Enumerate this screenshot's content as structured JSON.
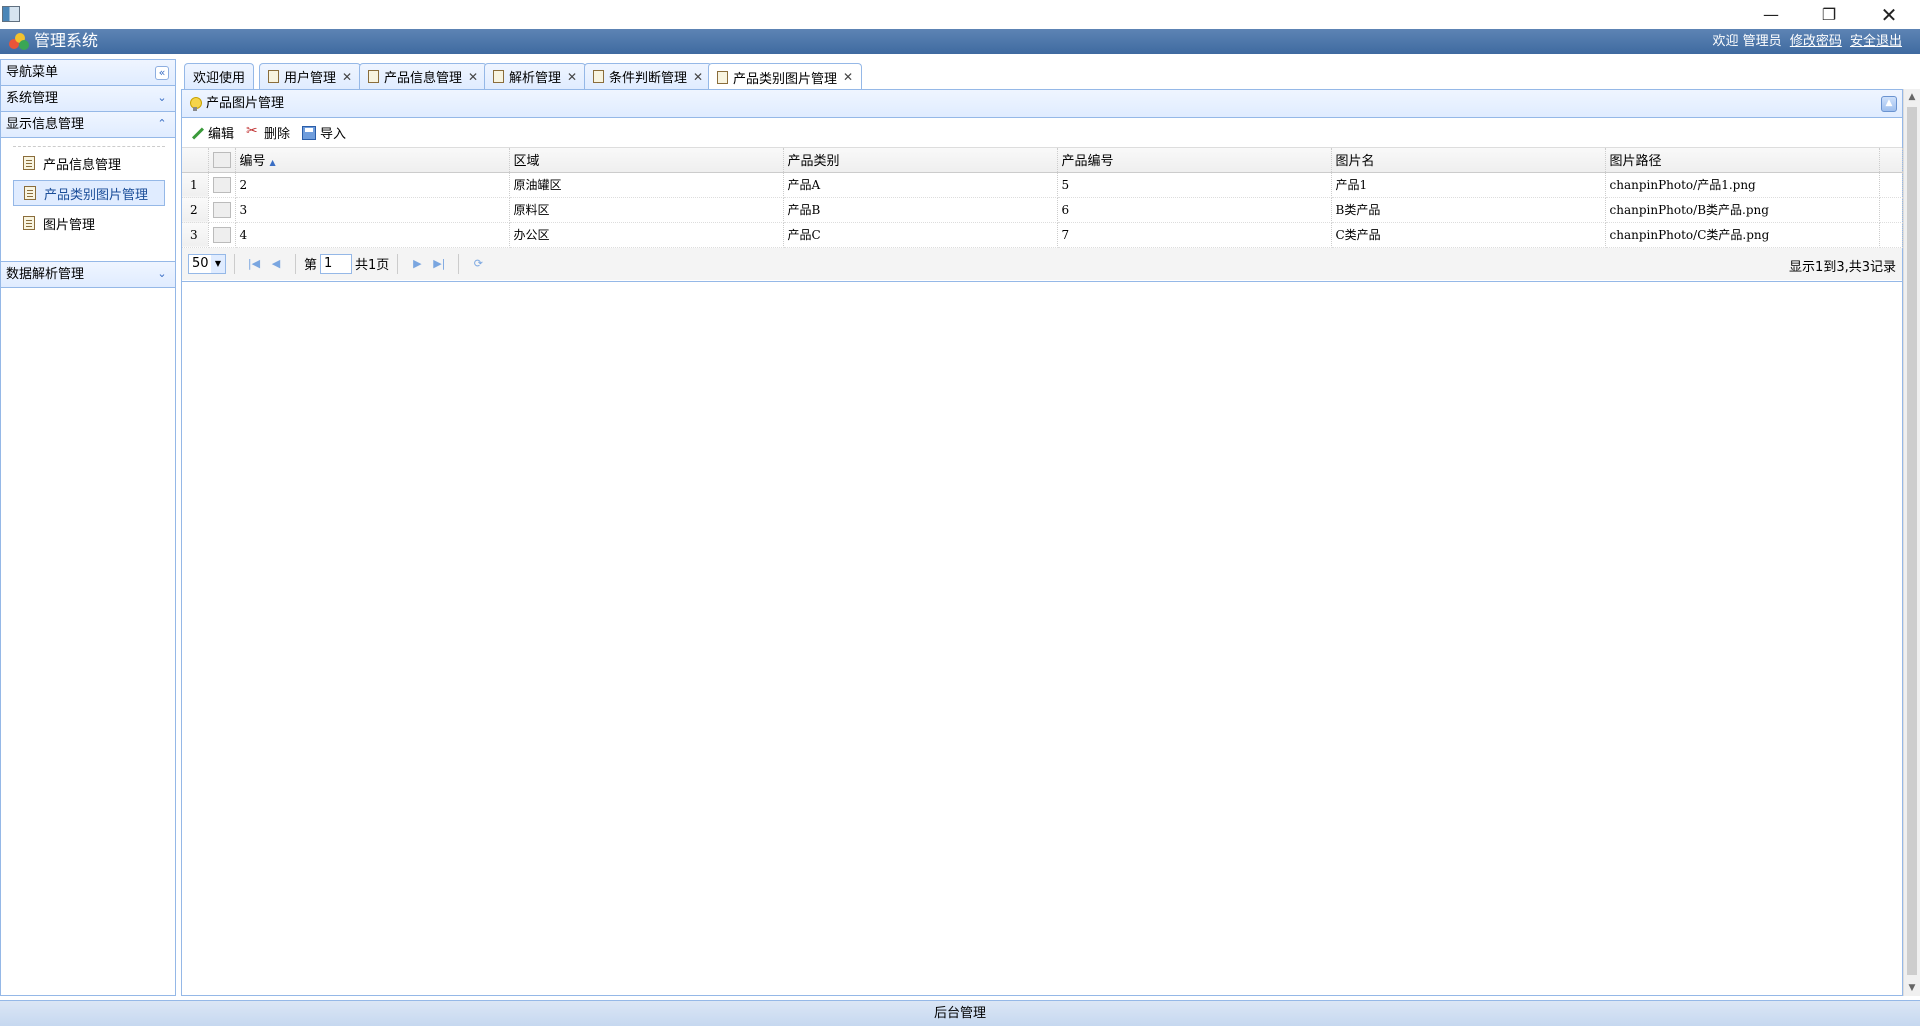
{
  "window": {
    "minimize": "—",
    "maximize": "❐",
    "close": "✕"
  },
  "header": {
    "title": "管理系统",
    "welcome": "欢迎 管理员",
    "change_password": "修改密码",
    "logout": "安全退出"
  },
  "sidebar": {
    "title": "导航菜单",
    "sections": [
      {
        "label": "系统管理",
        "expanded": false
      },
      {
        "label": "显示信息管理",
        "expanded": true,
        "items": [
          {
            "label": "产品信息管理",
            "selected": false
          },
          {
            "label": "产品类别图片管理",
            "selected": true
          },
          {
            "label": "图片管理",
            "selected": false
          }
        ]
      },
      {
        "label": "数据解析管理",
        "expanded": false
      }
    ]
  },
  "tabs": [
    {
      "label": "欢迎使用",
      "closable": false,
      "active": false
    },
    {
      "label": "用户管理",
      "closable": true,
      "active": false
    },
    {
      "label": "产品信息管理",
      "closable": true,
      "active": false
    },
    {
      "label": "解析管理",
      "closable": true,
      "active": false
    },
    {
      "label": "条件判断管理",
      "closable": true,
      "active": false
    },
    {
      "label": "产品类别图片管理",
      "closable": true,
      "active": true
    }
  ],
  "panel": {
    "title": "产品图片管理",
    "toolbar": {
      "edit": "编辑",
      "delete": "删除",
      "import": "导入"
    }
  },
  "grid": {
    "columns": [
      "编号",
      "区域",
      "产品类别",
      "产品编号",
      "图片名",
      "图片路径"
    ],
    "rows": [
      {
        "rownum": "1",
        "cells": [
          "2",
          "原油罐区",
          "产品A",
          "5",
          "产品1",
          "chanpinPhoto/产品1.png"
        ]
      },
      {
        "rownum": "2",
        "cells": [
          "3",
          "原料区",
          "产品B",
          "6",
          "B类产品",
          "chanpinPhoto/B类产品.png"
        ]
      },
      {
        "rownum": "3",
        "cells": [
          "4",
          "办公区",
          "产品C",
          "7",
          "C类产品",
          "chanpinPhoto/C类产品.png"
        ]
      }
    ]
  },
  "pager": {
    "page_size": "50",
    "page_prefix": "第",
    "page_number": "1",
    "page_total": "共1页",
    "info": "显示1到3,共3记录"
  },
  "footer": {
    "text": "后台管理"
  },
  "colors": {
    "header": "#4a75aa",
    "border": "#95b8e7",
    "panel_head": "#e0ecff"
  }
}
